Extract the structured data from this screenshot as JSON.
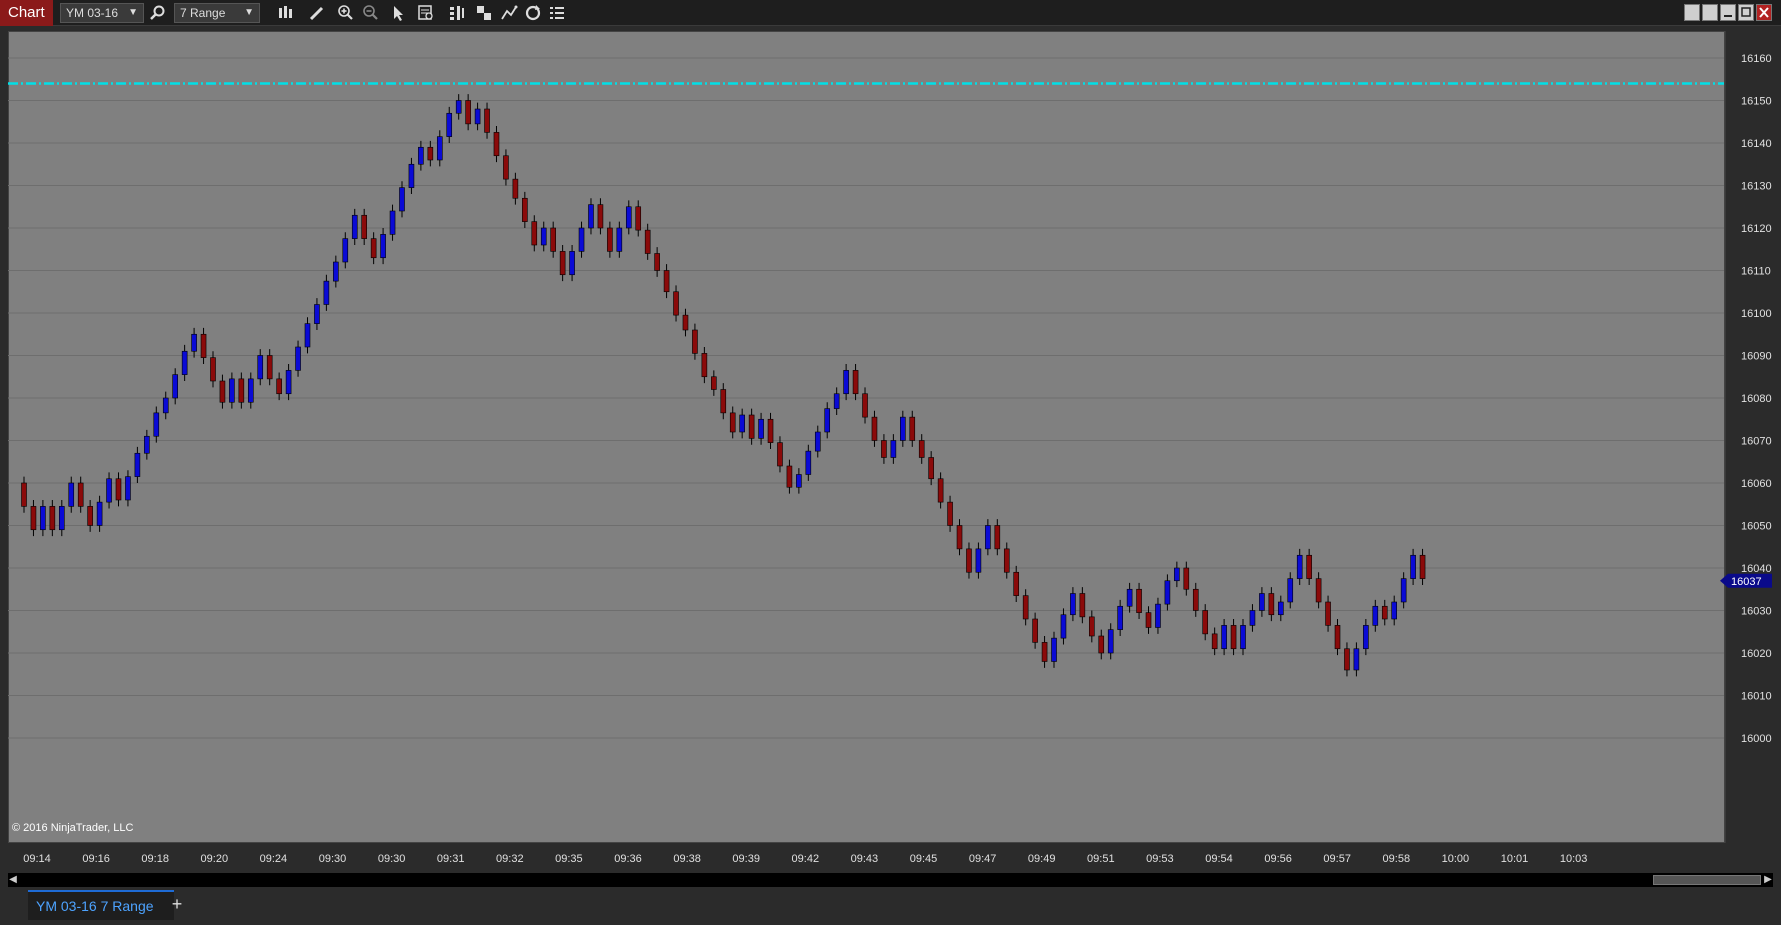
{
  "toolbar": {
    "title": "Chart",
    "instrument": "YM 03-16",
    "period": "7 Range",
    "icons": [
      "search-icon",
      "bar-style-icon",
      "pencil-icon",
      "zoom-in-icon",
      "zoom-out-icon",
      "pointer-icon",
      "data-box-icon",
      "indicators-icon",
      "strategies-icon",
      "drawing-tools-icon",
      "reload-icon",
      "properties-icon"
    ]
  },
  "window_controls": [
    "restore-icon",
    "tile-icon",
    "minimize-icon",
    "maximize-icon",
    "close-icon"
  ],
  "chart": {
    "copyright": "© 2016 NinjaTrader, LLC",
    "last_price_label": "16037",
    "colors": {
      "up": "#0a0ad6",
      "down": "#8b0a0a",
      "line": "#00e0e8",
      "background": "#808080",
      "badge": "#0a0a8a"
    }
  },
  "chart_data": {
    "type": "candlestick",
    "instrument": "YM 03-16",
    "period": "7 Range",
    "y_ticks": [
      "16160",
      "16150",
      "16140",
      "16130",
      "16120",
      "16110",
      "16100",
      "16090",
      "16080",
      "16070",
      "16060",
      "16050",
      "16040",
      "16030",
      "16020",
      "16010",
      "16000"
    ],
    "ylim": [
      16000,
      16160
    ],
    "x_ticks": [
      "09:14",
      "09:16",
      "09:18",
      "09:20",
      "09:24",
      "09:30",
      "09:30",
      "09:31",
      "09:32",
      "09:35",
      "09:36",
      "09:38",
      "09:39",
      "09:42",
      "09:43",
      "09:45",
      "09:47",
      "09:49",
      "09:51",
      "09:53",
      "09:54",
      "09:56",
      "09:57",
      "09:58",
      "10:00",
      "10:01",
      "10:03"
    ],
    "horizontal_line": 16154,
    "last_price": 16037,
    "path": [
      16060,
      16047,
      16057,
      16047,
      16055,
      16052,
      16060,
      16052,
      16050,
      16061,
      16056,
      16064,
      16071,
      16080,
      16079,
      16087,
      16083,
      16095,
      16079,
      16081,
      16087,
      16078,
      16090,
      16092,
      16081,
      16079,
      16093,
      16102,
      16112,
      16111,
      16125,
      16113,
      16121,
      16130,
      16128,
      16139,
      16136,
      16150,
      16148,
      16144,
      16148,
      16140,
      16127,
      16116,
      16120,
      16109,
      16117,
      16128,
      16119,
      16113,
      16125,
      16117,
      16110,
      16105,
      16096,
      16090,
      16082,
      16072,
      16076,
      16070,
      16075,
      16068,
      16059,
      16062,
      16070,
      16070,
      16072,
      16080,
      16081,
      16087,
      16080,
      16080,
      16075,
      16066,
      16070,
      16078,
      16066,
      16061,
      16048,
      16050,
      16038,
      16052,
      16042,
      16031,
      16020,
      16018,
      16034,
      16024,
      16020,
      16035,
      16026,
      16040,
      16035,
      16030,
      16023,
      16021,
      16027,
      16020,
      16030,
      16034,
      16035,
      16029,
      16032,
      16043,
      16032,
      16024,
      16016,
      16021,
      16031,
      16028,
      16032,
      16043,
      16036
    ]
  },
  "tabs": [
    {
      "label": "YM 03-16 7 Range",
      "active": true
    }
  ],
  "add_tab_label": "+"
}
